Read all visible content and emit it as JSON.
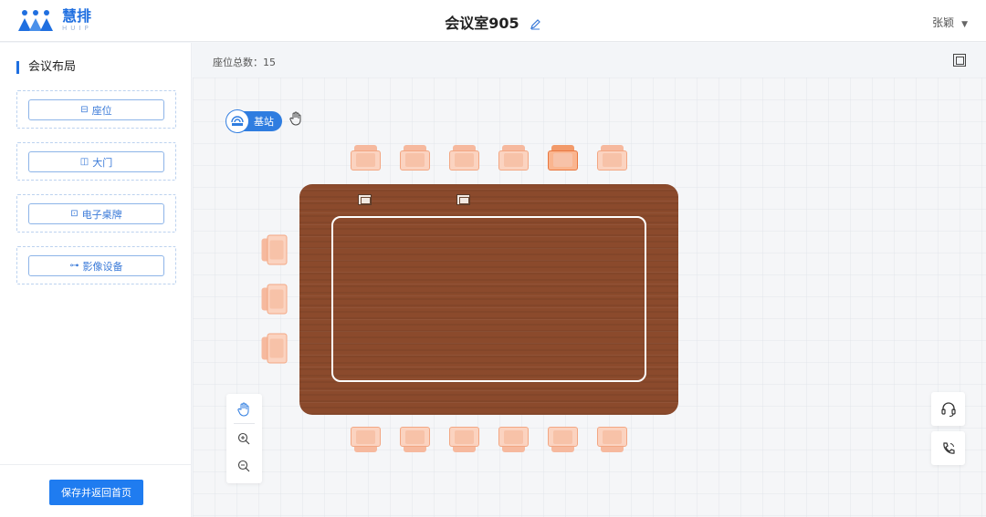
{
  "header": {
    "logo_name": "慧排",
    "logo_sub": "HUIP",
    "title": "会议室905",
    "user_name": "张颖"
  },
  "sidebar": {
    "section_title": "会议布局",
    "tools": [
      {
        "label": "座位",
        "icon": "seat-icon"
      },
      {
        "label": "大门",
        "icon": "door-icon"
      },
      {
        "label": "电子桌牌",
        "icon": "nameplate-icon"
      },
      {
        "label": "影像设备",
        "icon": "camera-icon"
      }
    ],
    "save_label": "保存并返回首页"
  },
  "main": {
    "seat_total_label": "座位总数：",
    "seat_total_value": "15",
    "base_station_label": "基站"
  },
  "colors": {
    "accent": "#1f7cf0",
    "table_wood": "#8b4a2c",
    "seat": "#fbd3c0",
    "seat_active": "#fab58f"
  }
}
